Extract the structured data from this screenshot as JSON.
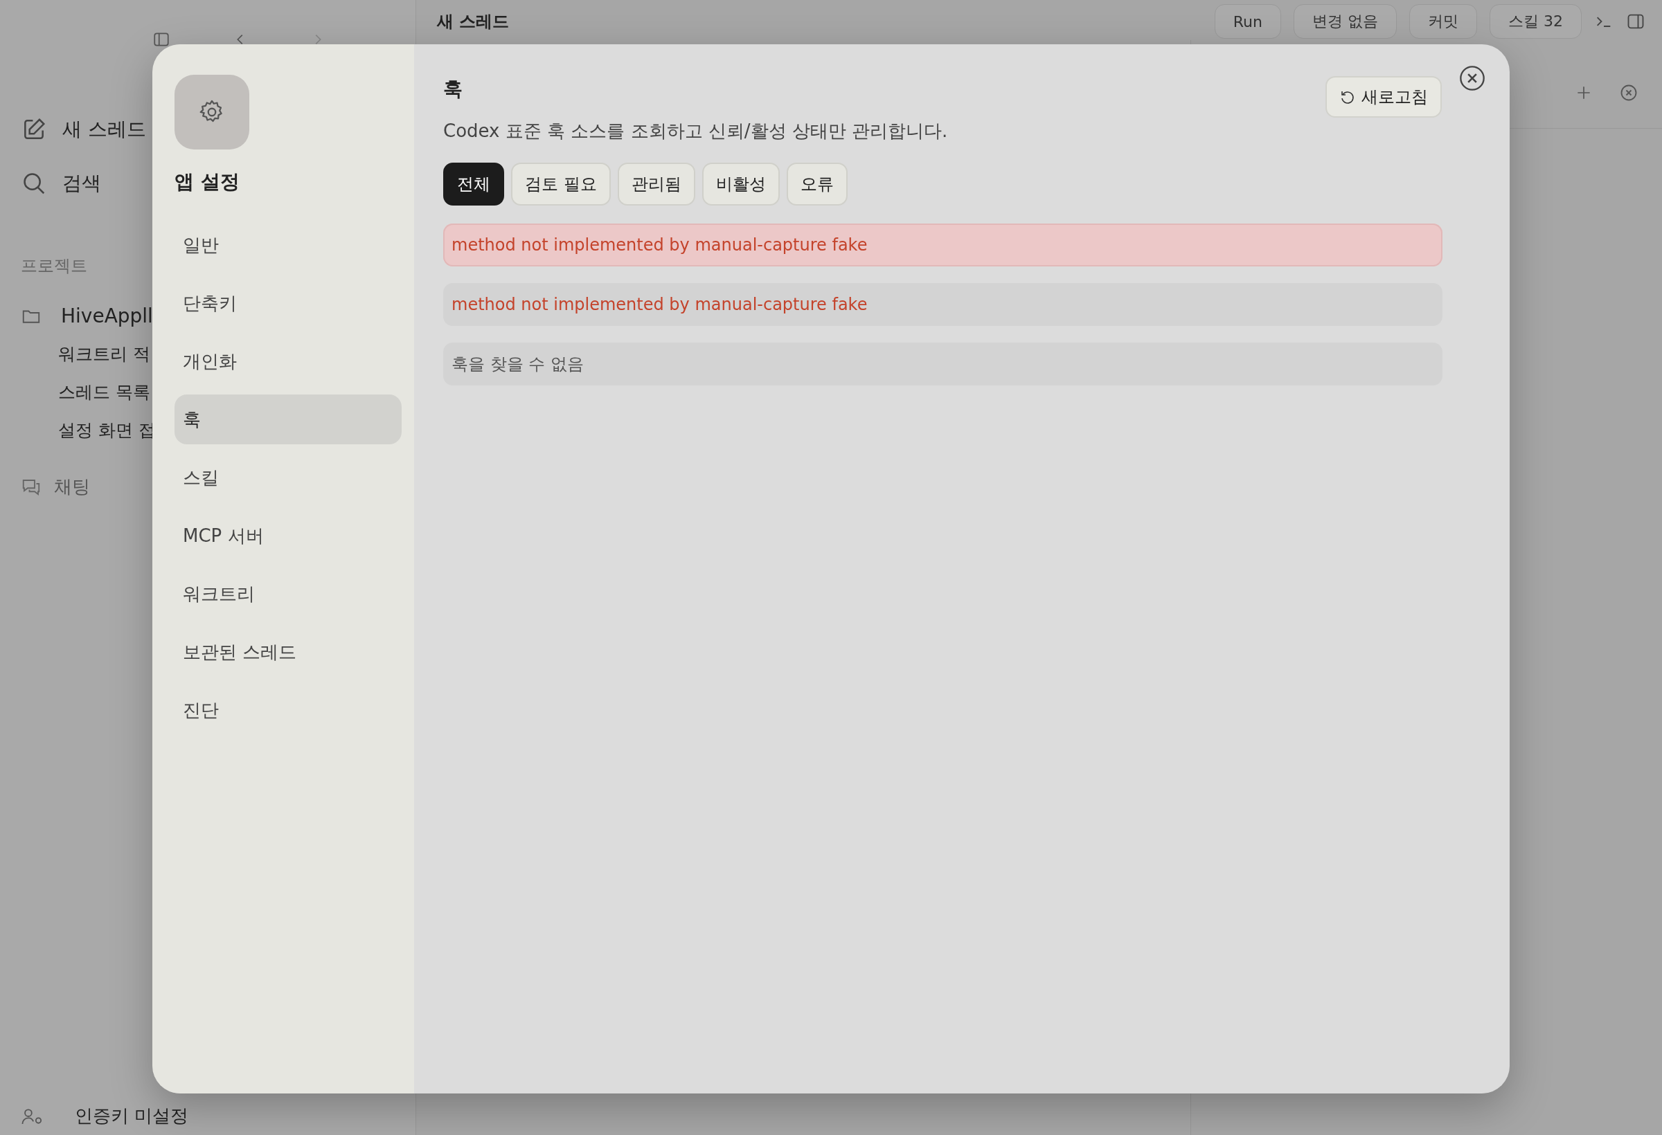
{
  "toolbar": {
    "title": "새 스레드",
    "run": "Run",
    "changes": "변경 없음",
    "commit": "커밋",
    "skills": "스킬 32"
  },
  "sidebar": {
    "actions": [
      "새 스레드",
      "검색"
    ],
    "section": "프로젝트",
    "project": {
      "name": "HiveAppll",
      "threads": [
        "워크트리 적",
        "스레드 목록",
        "설정 화면 접"
      ]
    },
    "chat": "채팅",
    "footer": "인증키 미설정"
  },
  "settings": {
    "title": "앱 설정",
    "nav": [
      {
        "label": "일반",
        "selected": false
      },
      {
        "label": "단축키",
        "selected": false
      },
      {
        "label": "개인화",
        "selected": false
      },
      {
        "label": "훅",
        "selected": true
      },
      {
        "label": "스킬",
        "selected": false
      },
      {
        "label": "MCP 서버",
        "selected": false
      },
      {
        "label": "워크트리",
        "selected": false
      },
      {
        "label": "보관된 스레드",
        "selected": false
      },
      {
        "label": "진단",
        "selected": false
      }
    ],
    "heading": "훅",
    "description": "Codex 표준 훅 소스를 조회하고 신뢰/활성 상태만 관리합니다.",
    "refresh": "새로고침",
    "filters": [
      {
        "label": "전체",
        "selected": true
      },
      {
        "label": "검토 필요",
        "selected": false
      },
      {
        "label": "관리됨",
        "selected": false
      },
      {
        "label": "비활성",
        "selected": false
      },
      {
        "label": "오류",
        "selected": false
      }
    ],
    "rows": [
      {
        "kind": "error",
        "highlighted": true,
        "text": "method not implemented by manual-capture fake"
      },
      {
        "kind": "error",
        "highlighted": false,
        "text": "method not implemented by manual-capture fake"
      },
      {
        "kind": "empty",
        "highlighted": false,
        "text": "훅을 찾을 수 없음"
      }
    ]
  }
}
